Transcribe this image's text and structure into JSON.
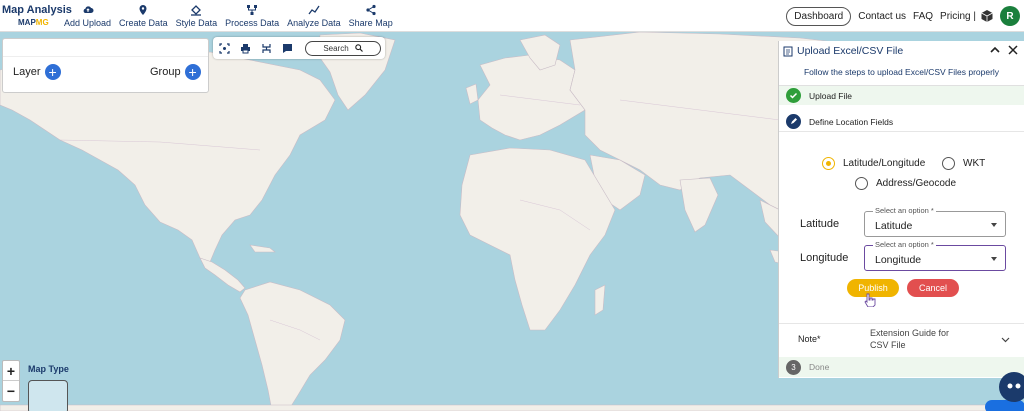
{
  "brand": {
    "line1": "Map Analysis",
    "line2a": "MAP",
    "line2b": "MG"
  },
  "nav": [
    {
      "label": "Add Upload",
      "icon": "cloud-upload-icon"
    },
    {
      "label": "Create Data",
      "icon": "map-pin-icon"
    },
    {
      "label": "Style Data",
      "icon": "paint-bucket-icon"
    },
    {
      "label": "Process Data",
      "icon": "process-icon"
    },
    {
      "label": "Analyze Data",
      "icon": "analyze-icon"
    },
    {
      "label": "Share Map",
      "icon": "share-icon"
    }
  ],
  "right_nav": {
    "dashboard": "Dashboard",
    "contact": "Contact us",
    "faq": "FAQ",
    "pricing": "Pricing |",
    "avatar": "R"
  },
  "layer_panel": {
    "layer": "Layer",
    "group": "Group"
  },
  "map_tools": {
    "search": "Search"
  },
  "zoom": {
    "in": "+",
    "out": "−"
  },
  "map_type": {
    "label": "Map Type"
  },
  "panel": {
    "title": "Upload Excel/CSV File",
    "subtitle": "Follow the steps to upload Excel/CSV Files properly",
    "step1": "Upload File",
    "step2": "Define Location Fields",
    "radios": {
      "latlon": "Latitude/Longitude",
      "wkt": "WKT",
      "address": "Address/Geocode"
    },
    "latitude": {
      "label": "Latitude",
      "hint": "Select an option *",
      "value": "Latitude"
    },
    "longitude": {
      "label": "Longitude",
      "hint": "Select an option *",
      "value": "Longitude"
    },
    "publish": "Publish",
    "cancel": "Cancel",
    "note_label": "Note*",
    "note_text": "Extension Guide for CSV File",
    "step3_num": "3",
    "step3": "Done"
  },
  "colors": {
    "brand": "#1b3a6b",
    "accent": "#f0b400",
    "cancel": "#e24f4f",
    "ok": "#2e9e3a",
    "water": "#aad3df",
    "land": "#f2efe9"
  }
}
